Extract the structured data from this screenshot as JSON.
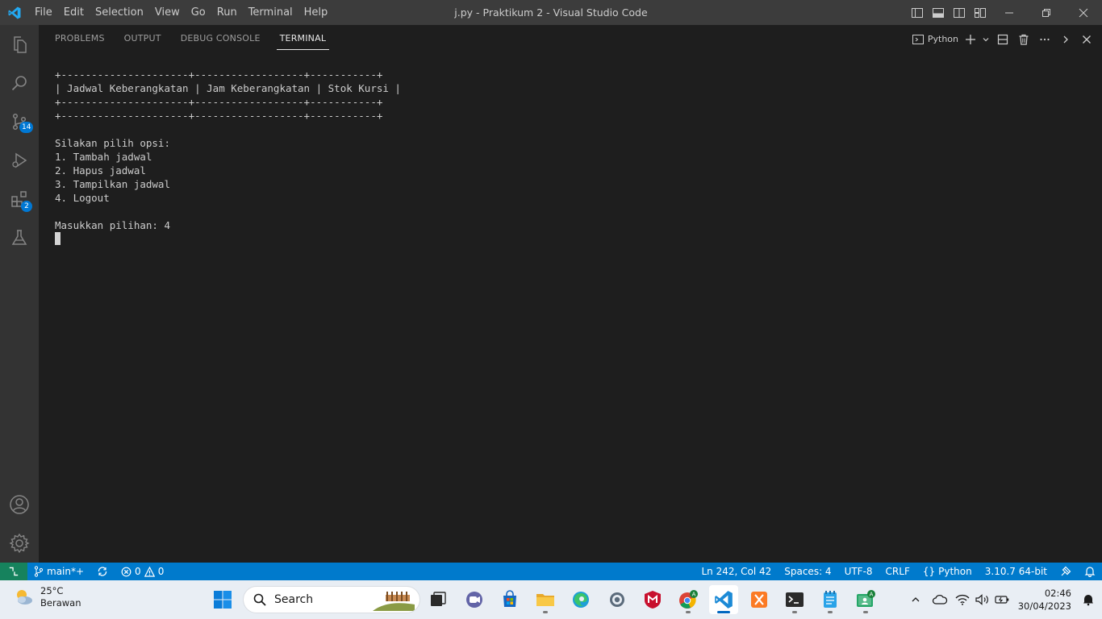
{
  "titlebar": {
    "menu": [
      "File",
      "Edit",
      "Selection",
      "View",
      "Go",
      "Run",
      "Terminal",
      "Help"
    ],
    "title": "j.py - Praktikum 2 - Visual Studio Code"
  },
  "activity": {
    "source_control_badge": "14",
    "extensions_badge": "2"
  },
  "panel": {
    "tabs": [
      "PROBLEMS",
      "OUTPUT",
      "DEBUG CONSOLE",
      "TERMINAL"
    ],
    "active_tab": "TERMINAL",
    "terminal_name": "Python"
  },
  "terminal": {
    "lines": [
      "+---------------------+------------------+-----------+",
      "| Jadwal Keberangkatan | Jam Keberangkatan | Stok Kursi |",
      "+---------------------+------------------+-----------+",
      "+---------------------+------------------+-----------+",
      "",
      "Silakan pilih opsi:",
      "1. Tambah jadwal",
      "2. Hapus jadwal",
      "3. Tampilkan jadwal",
      "4. Logout",
      "",
      "Masukkan pilihan: 4"
    ]
  },
  "statusbar": {
    "branch": "main*+",
    "errors": "0",
    "warnings": "0",
    "position": "Ln 242, Col 42",
    "spaces": "Spaces: 4",
    "encoding": "UTF-8",
    "eol": "CRLF",
    "language": "Python",
    "interpreter": "3.10.7 64-bit"
  },
  "taskbar": {
    "temperature": "25°C",
    "weather_desc": "Berawan",
    "search_placeholder": "Search",
    "time": "02:46",
    "date": "30/04/2023"
  },
  "colors": {
    "accent": "#007acc",
    "remote": "#16825d",
    "titlebar": "#3c3c3c",
    "activitybar": "#333333",
    "editor_bg": "#1e1e1e"
  }
}
